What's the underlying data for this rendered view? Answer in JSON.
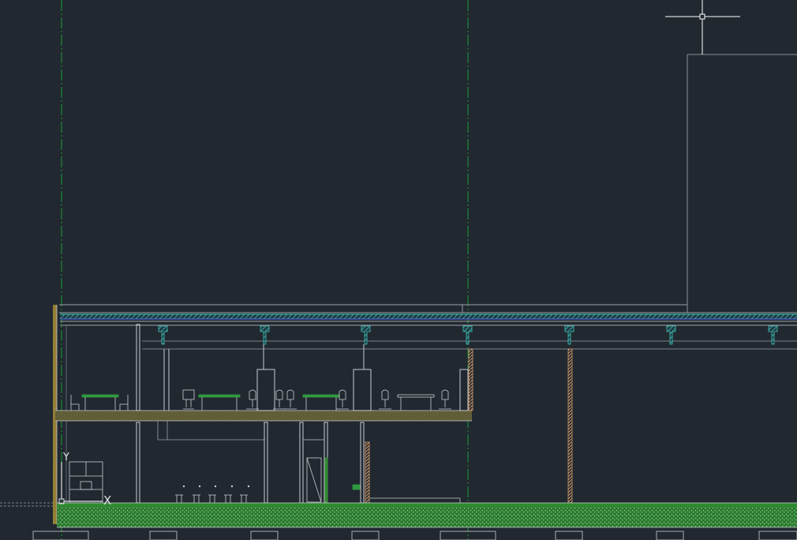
{
  "canvas": {
    "background": "#212830",
    "linework_color": "#c8ccd2",
    "grid_axis_color": "#1d9a3a",
    "roof_accent_color": "#3a8f8a",
    "floor_color": "#5e5a36",
    "ground_fill_color": "#2a8a2e",
    "wall_hatch_color": "#c99a5a"
  },
  "ucs_icon": {
    "x_label": "X",
    "y_label": "Y",
    "icon": "ucs-axis-icon"
  },
  "cursor": {
    "icon": "crosshair-cursor-icon"
  },
  "drawing": {
    "view": "building-section",
    "hatch_patterns": [
      "roof-insulation",
      "ground-gravel",
      "wall-brick"
    ]
  }
}
